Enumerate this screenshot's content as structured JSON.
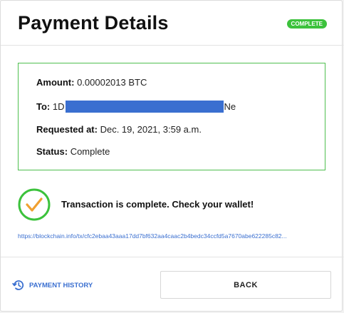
{
  "header": {
    "title": "Payment Details",
    "badge": "COMPLETE"
  },
  "details": {
    "amount_label": "Amount:",
    "amount_value": "0.00002013 BTC",
    "to_label": "To:",
    "to_prefix": "1D",
    "to_suffix": "Ne",
    "requested_label": "Requested at:",
    "requested_value": "Dec. 19, 2021, 3:59 a.m.",
    "status_label": "Status:",
    "status_value": "Complete"
  },
  "status": {
    "message": "Transaction is complete. Check your wallet!",
    "link": "https://blockchain.info/tx/cfc2ebaa43aaa17dd7bf632aa4caac2b4bedc34ccfd5a7670abe622285c82..."
  },
  "footer": {
    "history_label": "PAYMENT HISTORY",
    "back_label": "BACK"
  },
  "icons": {
    "status_check": "check-circle-icon",
    "history": "history-icon"
  },
  "colors": {
    "badge": "#3cc23c",
    "box_border": "#4fbf4f",
    "check_ring": "#3cc23c",
    "check_mark": "#f0a030",
    "link": "#3a6fd0",
    "redaction": "#3a6fd0"
  }
}
